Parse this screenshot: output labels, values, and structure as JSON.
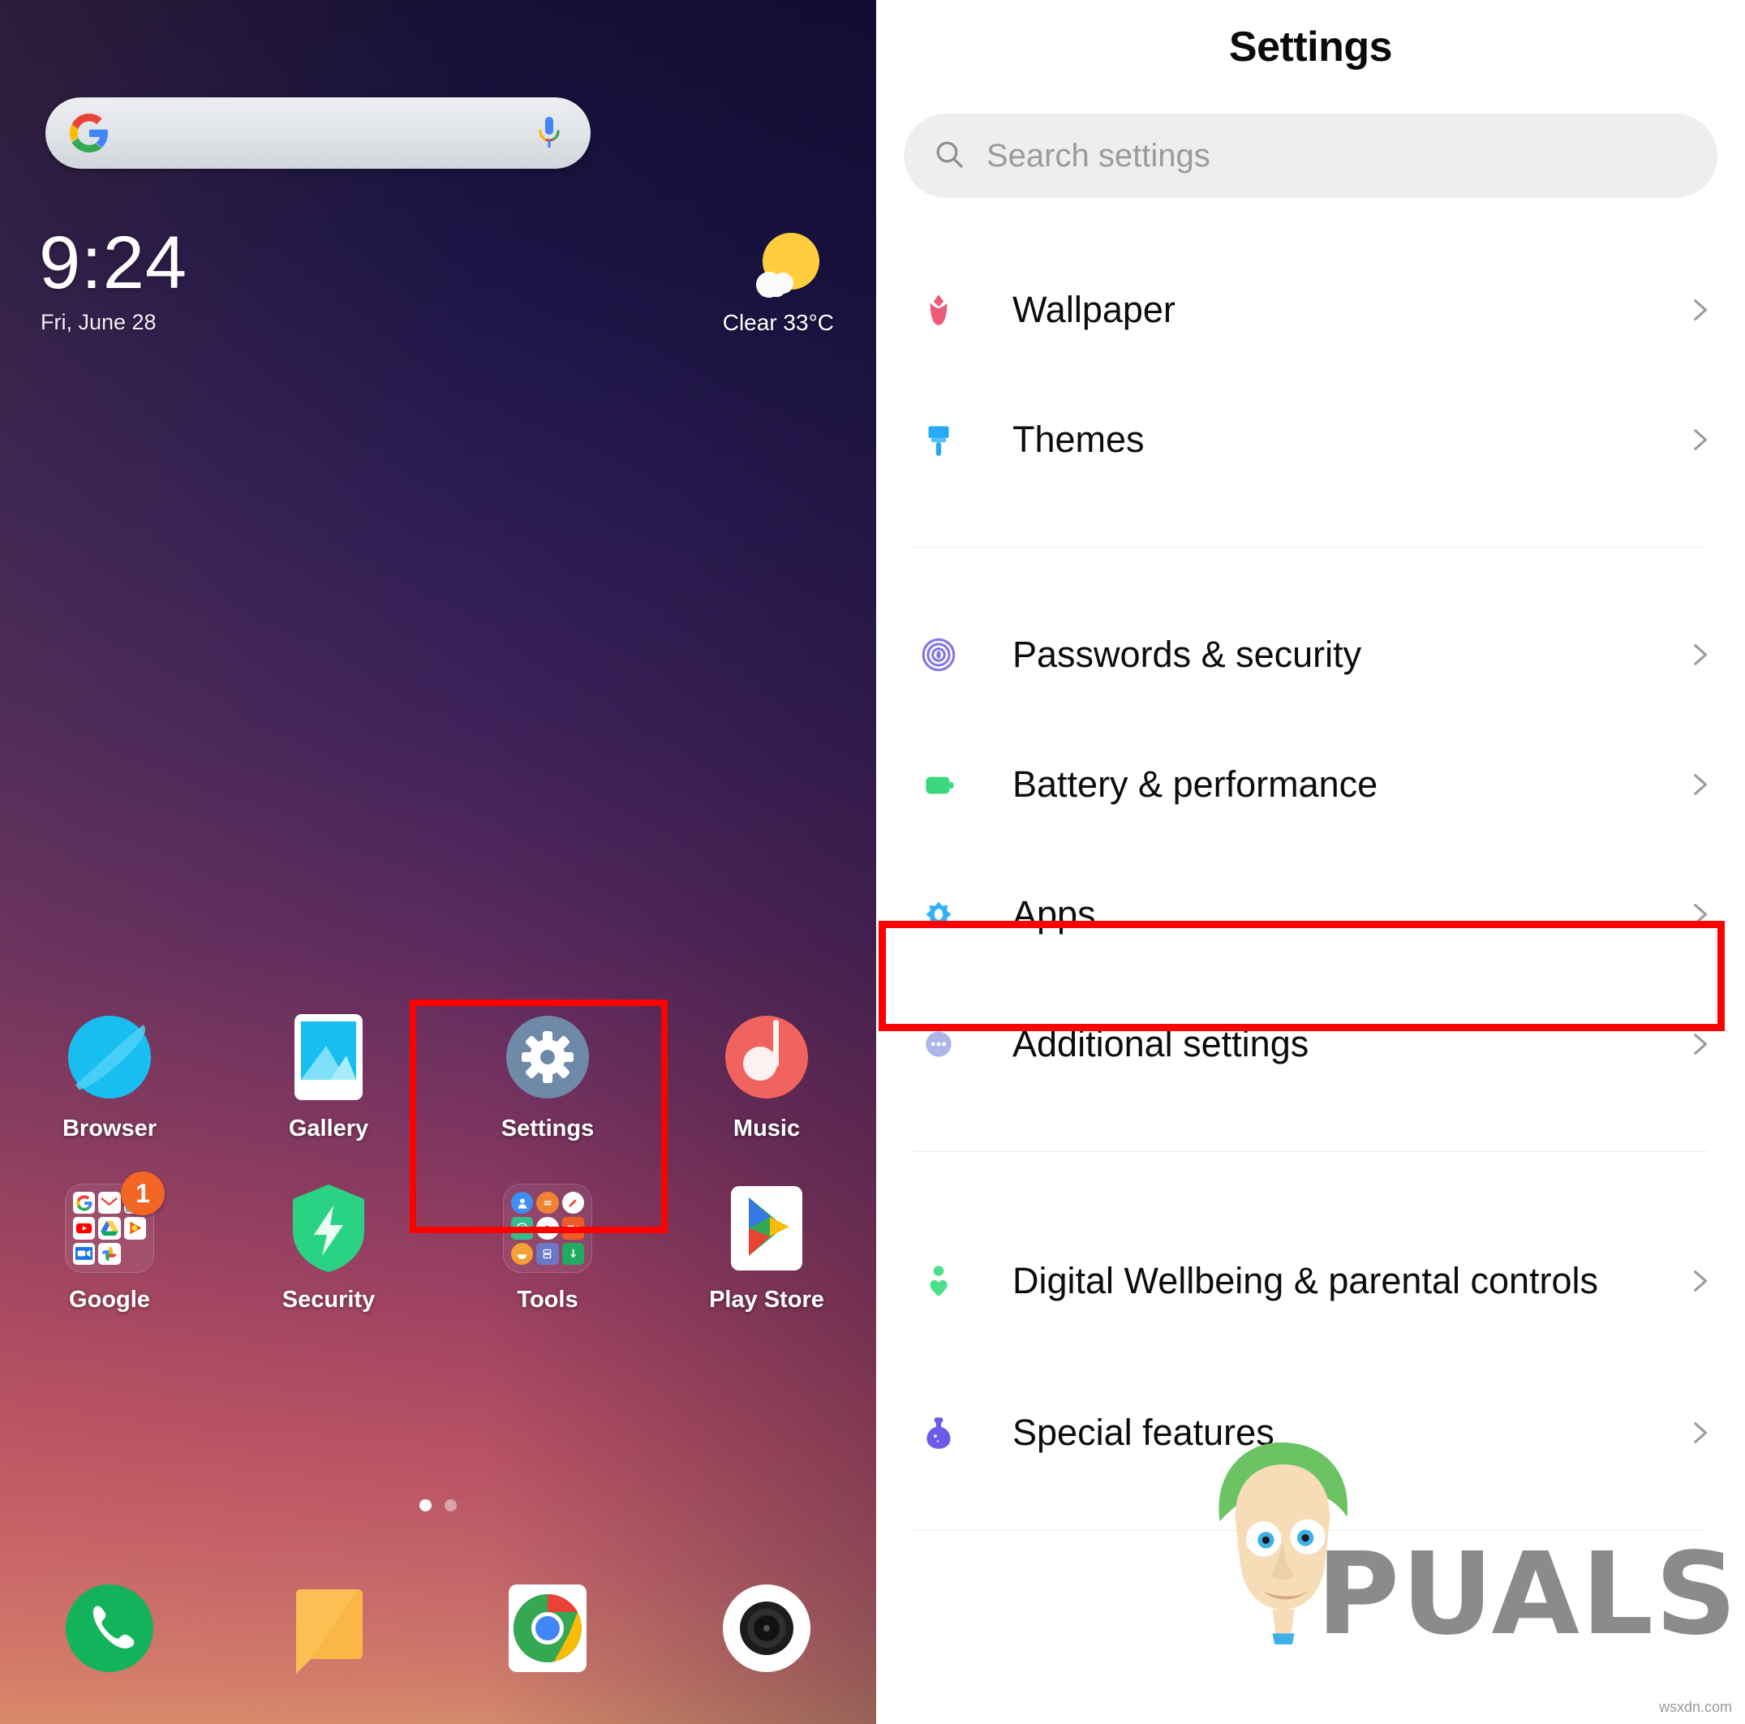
{
  "home": {
    "search_widget": {
      "logo": "google-g-logo",
      "mic": "microphone-icon"
    },
    "clock": {
      "time": "9:24",
      "date": "Fri, June 28"
    },
    "weather": {
      "icon": "sun-behind-cloud-icon",
      "condition": "Clear",
      "temperature": "33°C",
      "text": "Clear  33°C"
    },
    "apps": [
      {
        "label": "Browser",
        "icon": "browser-planet-icon"
      },
      {
        "label": "Gallery",
        "icon": "gallery-photo-icon"
      },
      {
        "label": "Settings",
        "icon": "settings-gear-icon",
        "highlighted": true
      },
      {
        "label": "Music",
        "icon": "music-note-icon"
      },
      {
        "label": "Google",
        "icon": "google-folder-icon",
        "badge": "1"
      },
      {
        "label": "Security",
        "icon": "security-shield-icon"
      },
      {
        "label": "Tools",
        "icon": "tools-folder-icon"
      },
      {
        "label": "Play Store",
        "icon": "play-store-icon"
      }
    ],
    "page_dots": {
      "count": 2,
      "active_index": 0
    },
    "dock": [
      {
        "label": "Phone",
        "icon": "phone-handset-icon"
      },
      {
        "label": "Messages",
        "icon": "message-bubble-icon"
      },
      {
        "label": "Chrome",
        "icon": "chrome-icon"
      },
      {
        "label": "Camera",
        "icon": "camera-lens-icon"
      }
    ]
  },
  "settings": {
    "title": "Settings",
    "search": {
      "placeholder": "Search settings",
      "icon": "search-icon"
    },
    "groups": [
      {
        "items": [
          {
            "label": "Wallpaper",
            "icon": "tulip-flower-icon",
            "color": "#ef5a78"
          },
          {
            "label": "Themes",
            "icon": "paint-brush-icon",
            "color": "#29a9f4"
          }
        ]
      },
      {
        "items": [
          {
            "label": "Passwords & security",
            "icon": "fingerprint-icon",
            "color": "#8376ea"
          },
          {
            "label": "Battery & performance",
            "icon": "battery-icon",
            "color": "#3ad97d"
          },
          {
            "label": "Apps",
            "icon": "apps-gear-flower-icon",
            "color": "#31b0f5",
            "highlighted": true
          },
          {
            "label": "Additional settings",
            "icon": "ellipsis-circle-icon",
            "color": "#aab6e8"
          }
        ]
      },
      {
        "items": [
          {
            "label": "Digital Wellbeing & parental controls",
            "icon": "wellbeing-person-heart-icon",
            "color": "#4ae08a"
          },
          {
            "label": "Special features",
            "icon": "potion-flask-icon",
            "color": "#6a5ae8"
          }
        ]
      }
    ],
    "chevron": "chevron-right-icon"
  },
  "watermark": {
    "brand": "PUALS",
    "mascot": "appuals-mascot-icon",
    "url": "wsxdn.com"
  },
  "colors": {
    "highlight": "#fe0000",
    "accent_blue": "#31b0f5",
    "settings_bg": "#ffffff"
  }
}
